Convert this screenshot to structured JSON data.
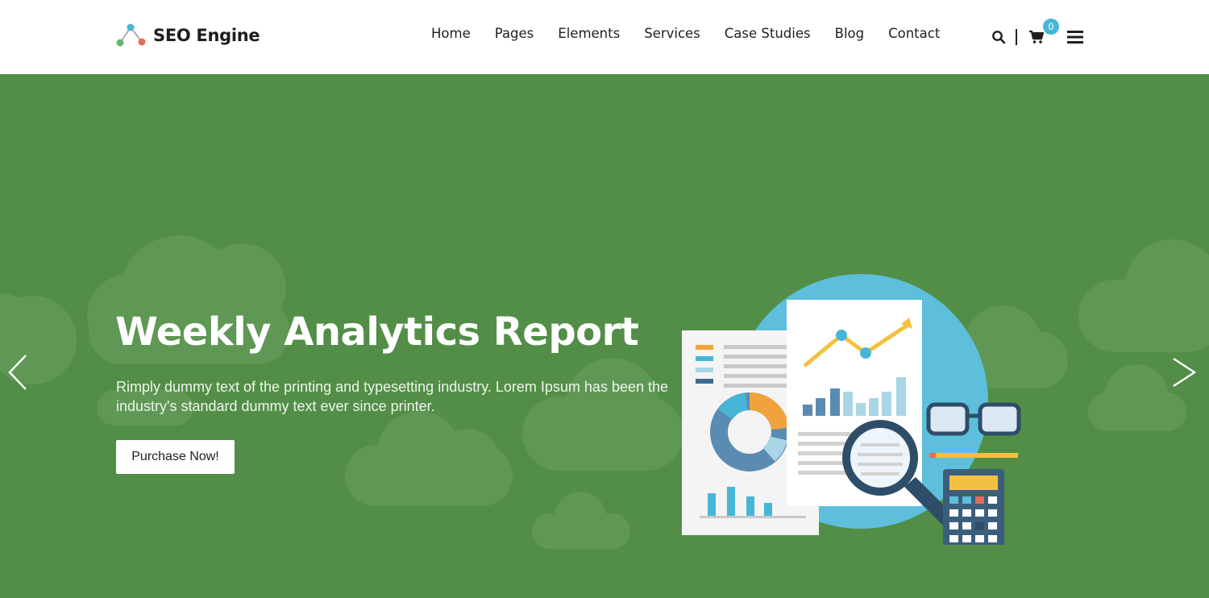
{
  "brand": {
    "name": "SEO Engine"
  },
  "nav": {
    "items": [
      {
        "label": "Home"
      },
      {
        "label": "Pages"
      },
      {
        "label": "Elements"
      },
      {
        "label": "Services"
      },
      {
        "label": "Case Studies"
      },
      {
        "label": "Blog"
      },
      {
        "label": "Contact"
      }
    ]
  },
  "tools": {
    "search_icon": "search-icon",
    "cart_icon": "cart-icon",
    "cart_count": "0",
    "menu_icon": "hamburger-menu-icon"
  },
  "hero": {
    "title": "Weekly Analytics Report",
    "description": "Rimply dummy text of the printing and typesetting industry. Lorem Ipsum has been the industry's standard dummy text ever since printer.",
    "cta_label": "Purchase Now!"
  },
  "colors": {
    "hero_bg": "#528e47",
    "accent_blue": "#47b6d6",
    "accent_orange": "#f0a33c",
    "accent_red": "#e26d5a",
    "accent_green": "#65b96a"
  }
}
